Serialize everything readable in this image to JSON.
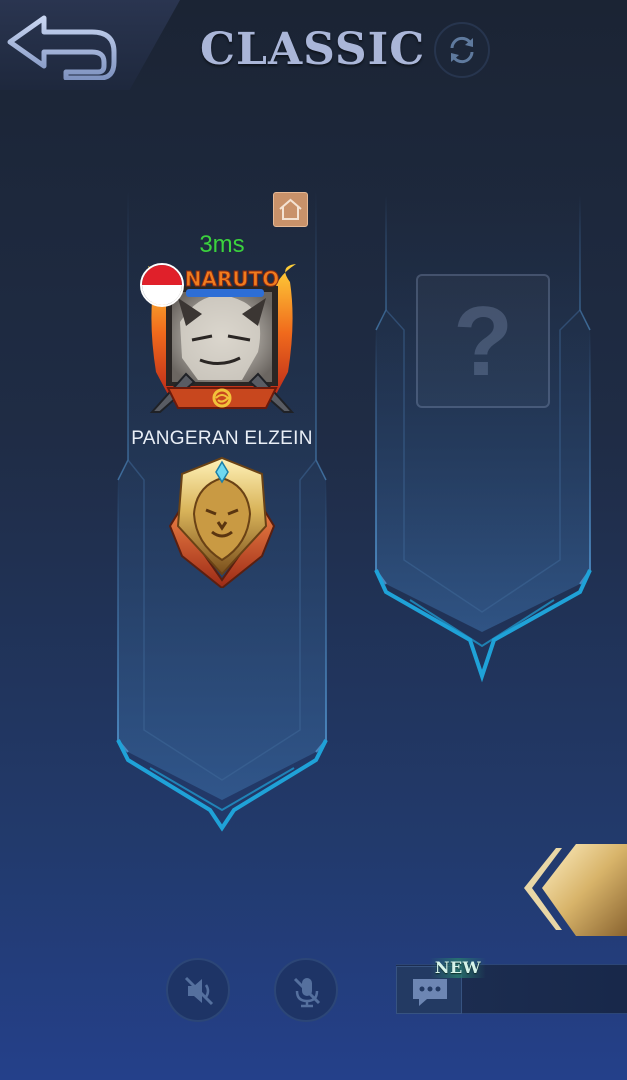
{
  "header": {
    "title": "CLASSIC",
    "back_icon": "back-arrow-icon",
    "refresh_icon": "refresh-icon"
  },
  "player_card": {
    "ping": "3ms",
    "name": "PANGERAN ELZEIN",
    "home_icon": "home-icon",
    "flag": "indonesia-flag",
    "avatar_text": "NARUTO",
    "rank_icon": "mythic-lion-rank-icon"
  },
  "empty_slot": {
    "symbol": "?"
  },
  "bottom_bar": {
    "speaker_icon": "speaker-muted-icon",
    "mic_icon": "mic-muted-icon",
    "chat_icon": "chat-icon",
    "new_label": "NEW"
  },
  "colors": {
    "ping_green": "#3bd23d",
    "frame_cyan": "#1fa2d8",
    "title_blue": "#aab6d8",
    "gold": "#d9b45a"
  }
}
